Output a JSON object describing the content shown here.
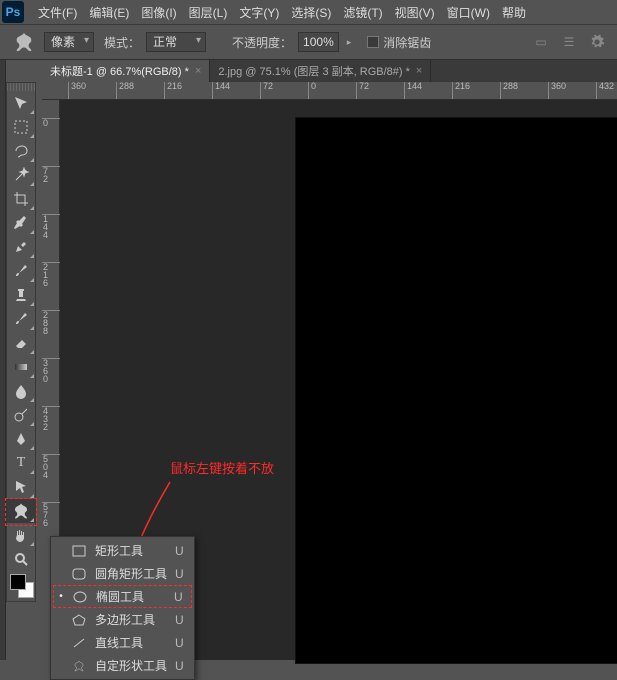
{
  "menubar": {
    "items": [
      {
        "label": "文件(F)"
      },
      {
        "label": "编辑(E)"
      },
      {
        "label": "图像(I)"
      },
      {
        "label": "图层(L)"
      },
      {
        "label": "文字(Y)"
      },
      {
        "label": "选择(S)"
      },
      {
        "label": "滤镜(T)"
      },
      {
        "label": "视图(V)"
      },
      {
        "label": "窗口(W)"
      },
      {
        "label": "帮助"
      }
    ]
  },
  "optionsbar": {
    "unit_label": "像素",
    "mode_label": "模式：",
    "mode_value": "正常",
    "opacity_label": "不透明度：",
    "opacity_value": "100%",
    "antialias_label": "消除锯齿"
  },
  "tabs": [
    {
      "title": "未标题-1 @ 66.7%(RGB/8) *",
      "active": true
    },
    {
      "title": "2.jpg @ 75.1% (图层 3 副本, RGB/8#) *",
      "active": false
    }
  ],
  "ruler_h": [
    {
      "pos": 26,
      "label": "360"
    },
    {
      "pos": 74,
      "label": "288"
    },
    {
      "pos": 122,
      "label": "216"
    },
    {
      "pos": 170,
      "label": "144"
    },
    {
      "pos": 218,
      "label": "72"
    },
    {
      "pos": 266,
      "label": "0"
    },
    {
      "pos": 314,
      "label": "72"
    },
    {
      "pos": 362,
      "label": "144"
    },
    {
      "pos": 410,
      "label": "216"
    },
    {
      "pos": 458,
      "label": "288"
    },
    {
      "pos": 506,
      "label": "360"
    },
    {
      "pos": 554,
      "label": "432"
    }
  ],
  "ruler_v": [
    {
      "pos": 18,
      "label": "0"
    },
    {
      "pos": 66,
      "label": "72"
    },
    {
      "pos": 114,
      "label": "144"
    },
    {
      "pos": 162,
      "label": "216"
    },
    {
      "pos": 210,
      "label": "288"
    },
    {
      "pos": 258,
      "label": "360"
    },
    {
      "pos": 306,
      "label": "432"
    },
    {
      "pos": 354,
      "label": "504"
    },
    {
      "pos": 402,
      "label": "576"
    }
  ],
  "annotation": {
    "text": "鼠标左键按着不放"
  },
  "flyout": {
    "items": [
      {
        "label": "矩形工具",
        "shortcut": "U",
        "icon": "rect",
        "selected": false,
        "highlight": false
      },
      {
        "label": "圆角矩形工具",
        "shortcut": "U",
        "icon": "rrect",
        "selected": false,
        "highlight": false
      },
      {
        "label": "椭圆工具",
        "shortcut": "U",
        "icon": "ellipse",
        "selected": true,
        "highlight": true
      },
      {
        "label": "多边形工具",
        "shortcut": "U",
        "icon": "polygon",
        "selected": false,
        "highlight": false
      },
      {
        "label": "直线工具",
        "shortcut": "U",
        "icon": "line",
        "selected": false,
        "highlight": false
      },
      {
        "label": "自定形状工具",
        "shortcut": "U",
        "icon": "custom",
        "selected": false,
        "highlight": false
      }
    ]
  }
}
